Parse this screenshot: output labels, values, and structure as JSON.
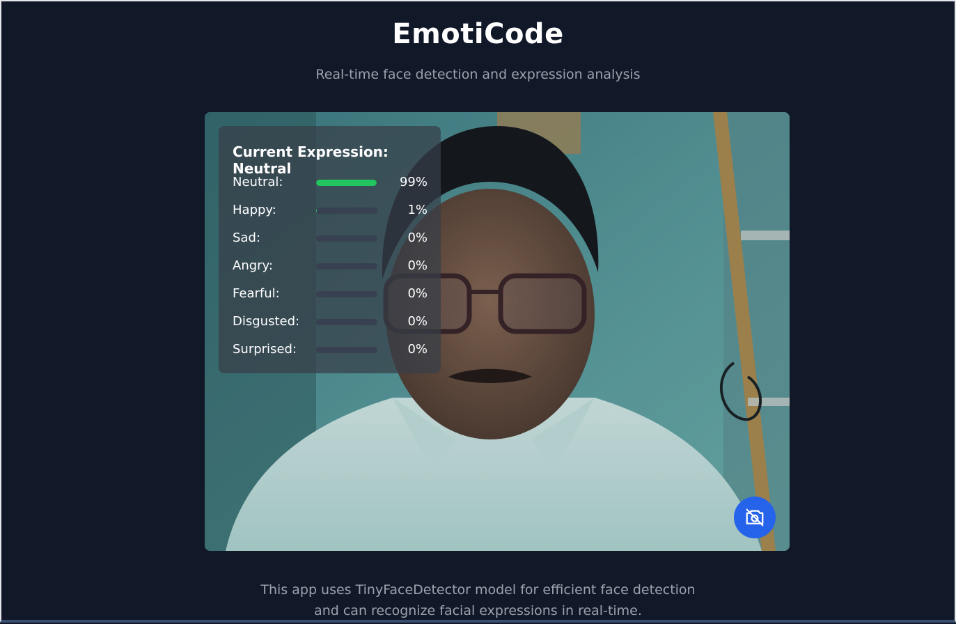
{
  "header": {
    "title": "EmotiCode",
    "subtitle": "Real-time face detection and expression analysis"
  },
  "video": {
    "panel": {
      "title": "Current Expression: Neutral",
      "expressions": [
        {
          "label": "Neutral:",
          "percent": "99%",
          "value": 0.99,
          "color": "#22c55e"
        },
        {
          "label": "Happy:",
          "percent": "1%",
          "value": 0.01,
          "color": "#22c55e"
        },
        {
          "label": "Sad:",
          "percent": "0%",
          "value": 0.0,
          "color": "#22c55e"
        },
        {
          "label": "Angry:",
          "percent": "0%",
          "value": 0.0,
          "color": "#22c55e"
        },
        {
          "label": "Fearful:",
          "percent": "0%",
          "value": 0.0,
          "color": "#22c55e"
        },
        {
          "label": "Disgusted:",
          "percent": "0%",
          "value": 0.0,
          "color": "#22c55e"
        },
        {
          "label": "Surprised:",
          "percent": "0%",
          "value": 0.0,
          "color": "#22c55e"
        }
      ]
    },
    "camera_button": {
      "icon": "camera-off-icon",
      "color": "#2563eb"
    }
  },
  "footer": {
    "line1": "This app uses TinyFaceDetector model for efficient face detection",
    "line2": "and can recognize facial expressions in real-time."
  }
}
